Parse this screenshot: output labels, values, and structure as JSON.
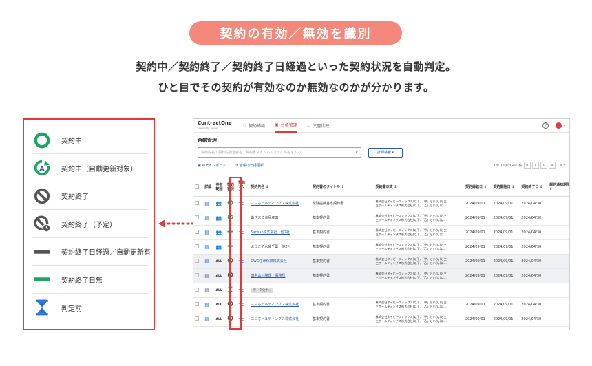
{
  "header": {
    "pill": "契約の有効／無効を識別",
    "line1": "契約中／契約終了／契約終了日経過といった契約状況を自動判定。",
    "line2": "ひと目でその契約が有効なのか無効なのかが分かります。"
  },
  "legend": [
    {
      "icon": "active-circle-icon",
      "label": "契約中"
    },
    {
      "icon": "auto-renew-icon",
      "label": "契約中（自動更新対象）"
    },
    {
      "icon": "terminated-icon",
      "label": "契約終了"
    },
    {
      "icon": "terminated-scheduled-icon",
      "label": "契約終了（予定）"
    },
    {
      "icon": "gray-bar-icon",
      "label": "契約終了日経過／自動更新有"
    },
    {
      "icon": "green-bar-icon",
      "label": "契約終了日無"
    },
    {
      "icon": "hourglass-icon",
      "label": "判定前"
    }
  ],
  "colors": {
    "accent": "#e53935",
    "pill": "#f4887a",
    "green": "#1fa463",
    "link": "#2a5db0",
    "gray": "#666666",
    "blue": "#2a6fd6"
  },
  "app": {
    "logo": "ContractOne",
    "logo_sub": "powered by Sansan",
    "nav": [
      {
        "label": "契約締結",
        "active": false
      },
      {
        "label": "台帳管理",
        "active": true
      },
      {
        "label": "文書比較",
        "active": false
      }
    ],
    "page_title": "台帳管理",
    "search_placeholder": "契約先名・契約先担当者名・契約書タイトル・ファイル名を入力",
    "advanced_search": "詳細検索",
    "actions": {
      "pdf_import": "PDFインポート",
      "bulk_register": "台帳の一括更新"
    },
    "pager_text": "1〜100/13,403件",
    "columns": [
      "詳細",
      "共有範囲",
      "契約状況",
      "契約ツリー",
      "契約先名",
      "契約書のタイトル",
      "契約書本文",
      "契約締結日",
      "契約開始日",
      "契約終了日",
      "解約通知期限日"
    ],
    "rows": [
      {
        "shade": false,
        "share": "group",
        "status": "active",
        "company": "三三ホールディングス株式会社",
        "link": true,
        "title": "業務提携基本契約書",
        "body1": "株式会社ネイビーフォックス(以下、「甲」という。)と三",
        "body2": "三ホールディングス株式会社(以下、「乙」という。)は…",
        "d1": "2024/09/01",
        "d2": "2024/09/01",
        "d3": "2024/04/30"
      },
      {
        "shade": false,
        "share": "group",
        "status": "auto",
        "company": "あさまる食品産田",
        "link": false,
        "title": "基本契約書",
        "body1": "株式会社ネイビーフォックス(以下、「甲」という。)と三",
        "body2": "三ホールディングス株式会社(以下、「乙」という。)は…",
        "d1": "2024/09/01",
        "d2": "2024/09/01",
        "d3": "2024/04/30"
      },
      {
        "shade": false,
        "share": "group",
        "status": "green",
        "company": "Sansan株式会社　他2社",
        "link": true,
        "title": "基本契約書",
        "body1": "株式会社ネイビーフォックス(以下、「甲」という。)と三",
        "body2": "三ホールディングス株式会社(以下、「乙」という。)は…",
        "d1": "2024/09/01",
        "d2": "2024/09/01",
        "d3": "2024/04/30"
      },
      {
        "shade": false,
        "share": "group",
        "status": "gray",
        "company": "ようこそ水曜千葉　他2社",
        "link": false,
        "title": "基本契約書",
        "body1": "株式会社ネイビーフォックス(以下、「甲」という。)と三",
        "body2": "三ホールディングス株式会社(以下、「乙」という。)は…",
        "d1": "2024/09/01",
        "d2": "2024/09/01",
        "d3": "2024/04/30"
      },
      {
        "shade": true,
        "share": "ALL",
        "status": "ended",
        "company": "CWO生命保険株式会社",
        "link": true,
        "title": "基本契約書",
        "body1": "株式会社ネイビーフォックス(以下、「甲」という。)と三",
        "body2": "三ホールディングス株式会社(以下、「乙」という。)は…",
        "d1": "2024/09/01",
        "d2": "2024/09/01",
        "d3": "2024/04/30"
      },
      {
        "shade": true,
        "share": "ALL",
        "status": "ended",
        "company": "田中山川税理士事務所",
        "link": true,
        "title": "基本契約書",
        "body1": "株式会社ネイビーフォックス(以下、「甲」という。)と三",
        "body2": "三ホールディングス株式会社(以下、「乙」という。)は…",
        "d1": "2024/09/01",
        "d2": "2024/09/01",
        "d3": "2024/04/30"
      },
      {
        "shade": false,
        "share": "ALL",
        "status": "pending",
        "company": "データ化中…",
        "link": false,
        "tag": true,
        "title": "",
        "body1": "",
        "body2": "",
        "d1": "",
        "d2": "",
        "d3": ""
      },
      {
        "shade": false,
        "share": "ALL",
        "status": "ended",
        "company": "三三ホールディングス株式会社",
        "link": true,
        "title": "基本契約書",
        "body1": "株式会社ネイビーフォックス(以下、「甲」という。)と三",
        "body2": "三ホールディングス株式会社(以下、「乙」という。)は…",
        "d1": "2024/09/01",
        "d2": "2024/09/01",
        "d3": "2024/04/30"
      },
      {
        "shade": false,
        "share": "ALL",
        "status": "ended",
        "company": "三三ホールディングス株式会社",
        "link": true,
        "title": "基本契約書",
        "body1": "株式会社ネイビーフォックス(以下、「甲」という。)と三",
        "body2": "三ホールディングス株式会社(以下、「乙」という。)は…",
        "d1": "2024/09/01",
        "d2": "2024/09/01",
        "d3": "2024/04/30"
      }
    ]
  }
}
